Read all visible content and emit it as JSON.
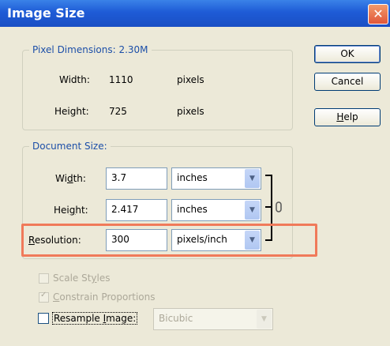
{
  "window": {
    "title": "Image Size",
    "close_glyph": "✕"
  },
  "pixel_dimensions": {
    "legend": "Pixel Dimensions:  2.30M",
    "width_label": "Width:",
    "width_value": "1110",
    "width_unit": "pixels",
    "height_label": "Height:",
    "height_value": "725",
    "height_unit": "pixels"
  },
  "document_size": {
    "legend": "Document Size:",
    "width_label_pre": "Wi",
    "width_label_u": "d",
    "width_label_post": "th:",
    "width_value": "3.7",
    "width_unit": "inches",
    "height_label_pre": "Hei",
    "height_label_u": "g",
    "height_label_post": "ht:",
    "height_value": "2.417",
    "height_unit": "inches",
    "resolution_label_u": "R",
    "resolution_label_post": "esolution:",
    "resolution_value": "300",
    "resolution_unit": "pixels/inch"
  },
  "buttons": {
    "ok": "OK",
    "cancel": "Cancel",
    "help_u": "H",
    "help_post": "elp"
  },
  "options": {
    "scale_styles_pre": "Scale St",
    "scale_styles_u": "y",
    "scale_styles_post": "les",
    "constrain_u": "C",
    "constrain_post": "onstrain Proportions",
    "resample_pre": "Resample ",
    "resample_u": "I",
    "resample_post": "mage:",
    "resample_method": "Bicubic",
    "scale_styles_checked": false,
    "constrain_checked": true,
    "resample_checked": false
  },
  "icons": {
    "dropdown": "chevron-down-icon",
    "link": "chain-link-icon",
    "check": "✓"
  },
  "colors": {
    "title_bar": "#1e5bd6",
    "legend_text": "#1c4fa8",
    "highlight": "#f07a5a",
    "dialog_bg": "#ece9d8"
  }
}
